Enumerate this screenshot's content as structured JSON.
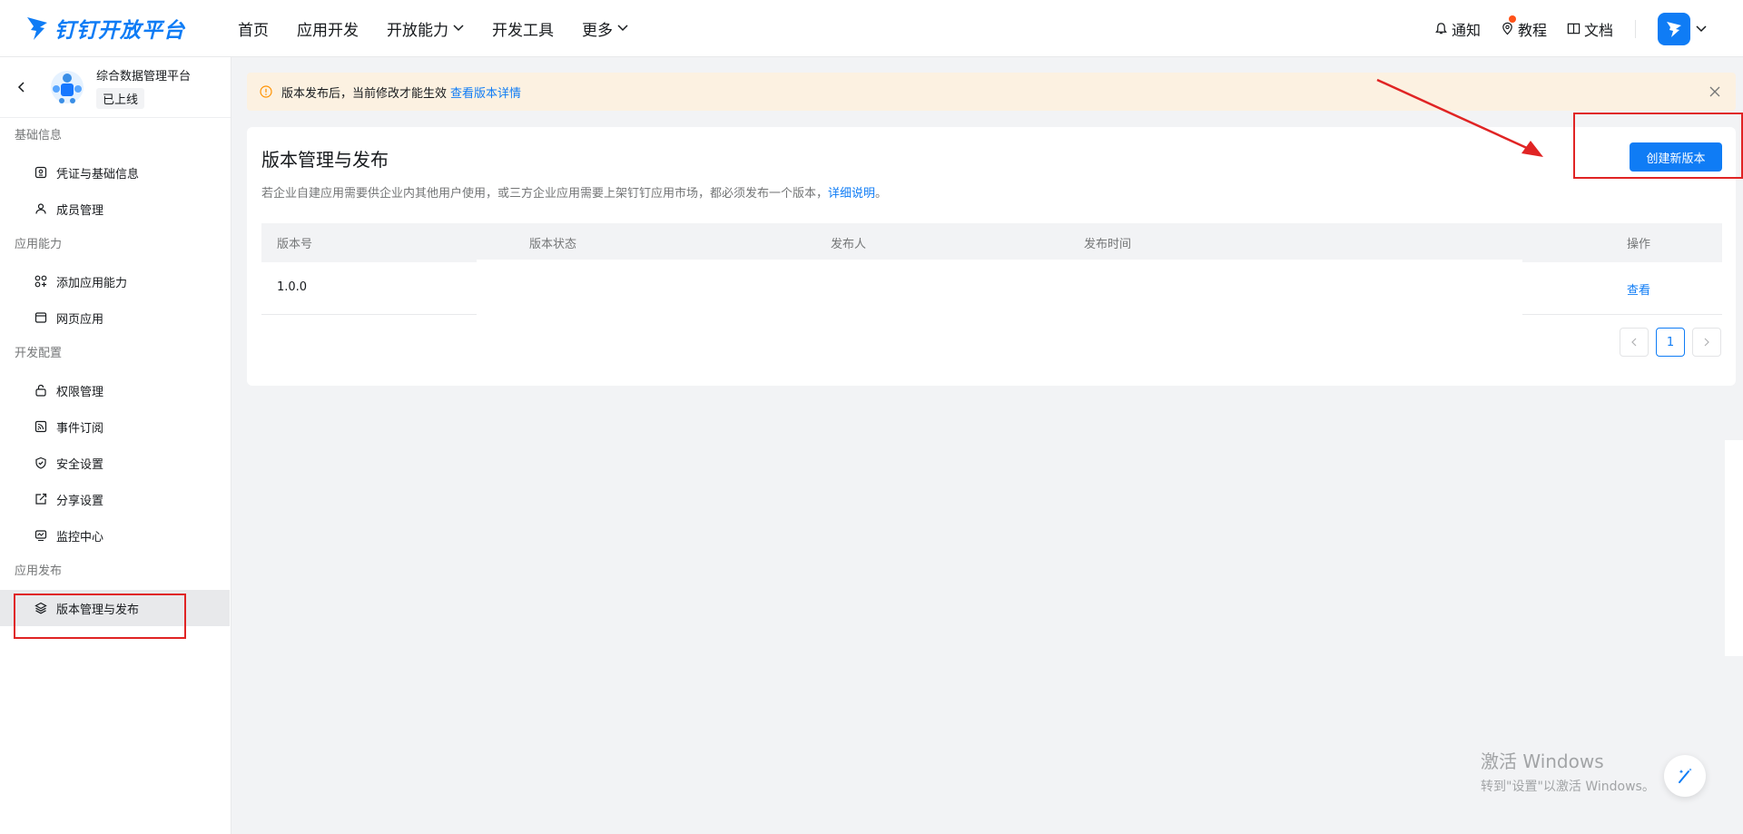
{
  "topnav": {
    "logo_text": "钉钉开放平台",
    "items": [
      {
        "label": "首页"
      },
      {
        "label": "应用开发"
      },
      {
        "label": "开放能力"
      },
      {
        "label": "开发工具"
      },
      {
        "label": "更多"
      }
    ],
    "right": {
      "notify": "通知",
      "tutorial": "教程",
      "docs": "文档"
    }
  },
  "sidebar": {
    "app_name": "综合数据管理平台",
    "app_status": "已上线",
    "groups": [
      {
        "label": "基础信息",
        "items": [
          {
            "label": "凭证与基础信息",
            "icon": "credential-icon"
          },
          {
            "label": "成员管理",
            "icon": "member-icon"
          }
        ]
      },
      {
        "label": "应用能力",
        "items": [
          {
            "label": "添加应用能力",
            "icon": "grid-plus-icon"
          },
          {
            "label": "网页应用",
            "icon": "browser-icon"
          }
        ]
      },
      {
        "label": "开发配置",
        "items": [
          {
            "label": "权限管理",
            "icon": "lock-icon"
          },
          {
            "label": "事件订阅",
            "icon": "rss-icon"
          },
          {
            "label": "安全设置",
            "icon": "shield-icon"
          },
          {
            "label": "分享设置",
            "icon": "share-icon"
          },
          {
            "label": "监控中心",
            "icon": "monitor-icon"
          }
        ]
      },
      {
        "label": "应用发布",
        "items": [
          {
            "label": "版本管理与发布",
            "icon": "layers-icon",
            "active": true
          }
        ]
      }
    ]
  },
  "alert": {
    "text": "版本发布后，当前修改才能生效",
    "link": "查看版本详情"
  },
  "card": {
    "title": "版本管理与发布",
    "desc": "若企业自建应用需要供企业内其他用户使用，或三方企业应用需要上架钉钉应用市场，都必须发布一个版本，",
    "desc_link": "详细说明",
    "desc_end": "。",
    "create_button": "创建新版本",
    "table": {
      "headers": [
        "版本号",
        "版本状态",
        "发布人",
        "发布时间",
        "操作"
      ],
      "rows": [
        {
          "version": "1.0.0",
          "status": "",
          "publisher": "",
          "time": "",
          "action": "查看"
        }
      ]
    },
    "pager": {
      "current": "1"
    }
  },
  "watermark": {
    "line1": "激活 Windows",
    "line2": "转到\"设置\"以激活 Windows。"
  },
  "colors": {
    "accent": "#0f7cf5",
    "annotation": "#e02424",
    "alert_bg": "#fcf1e1"
  }
}
